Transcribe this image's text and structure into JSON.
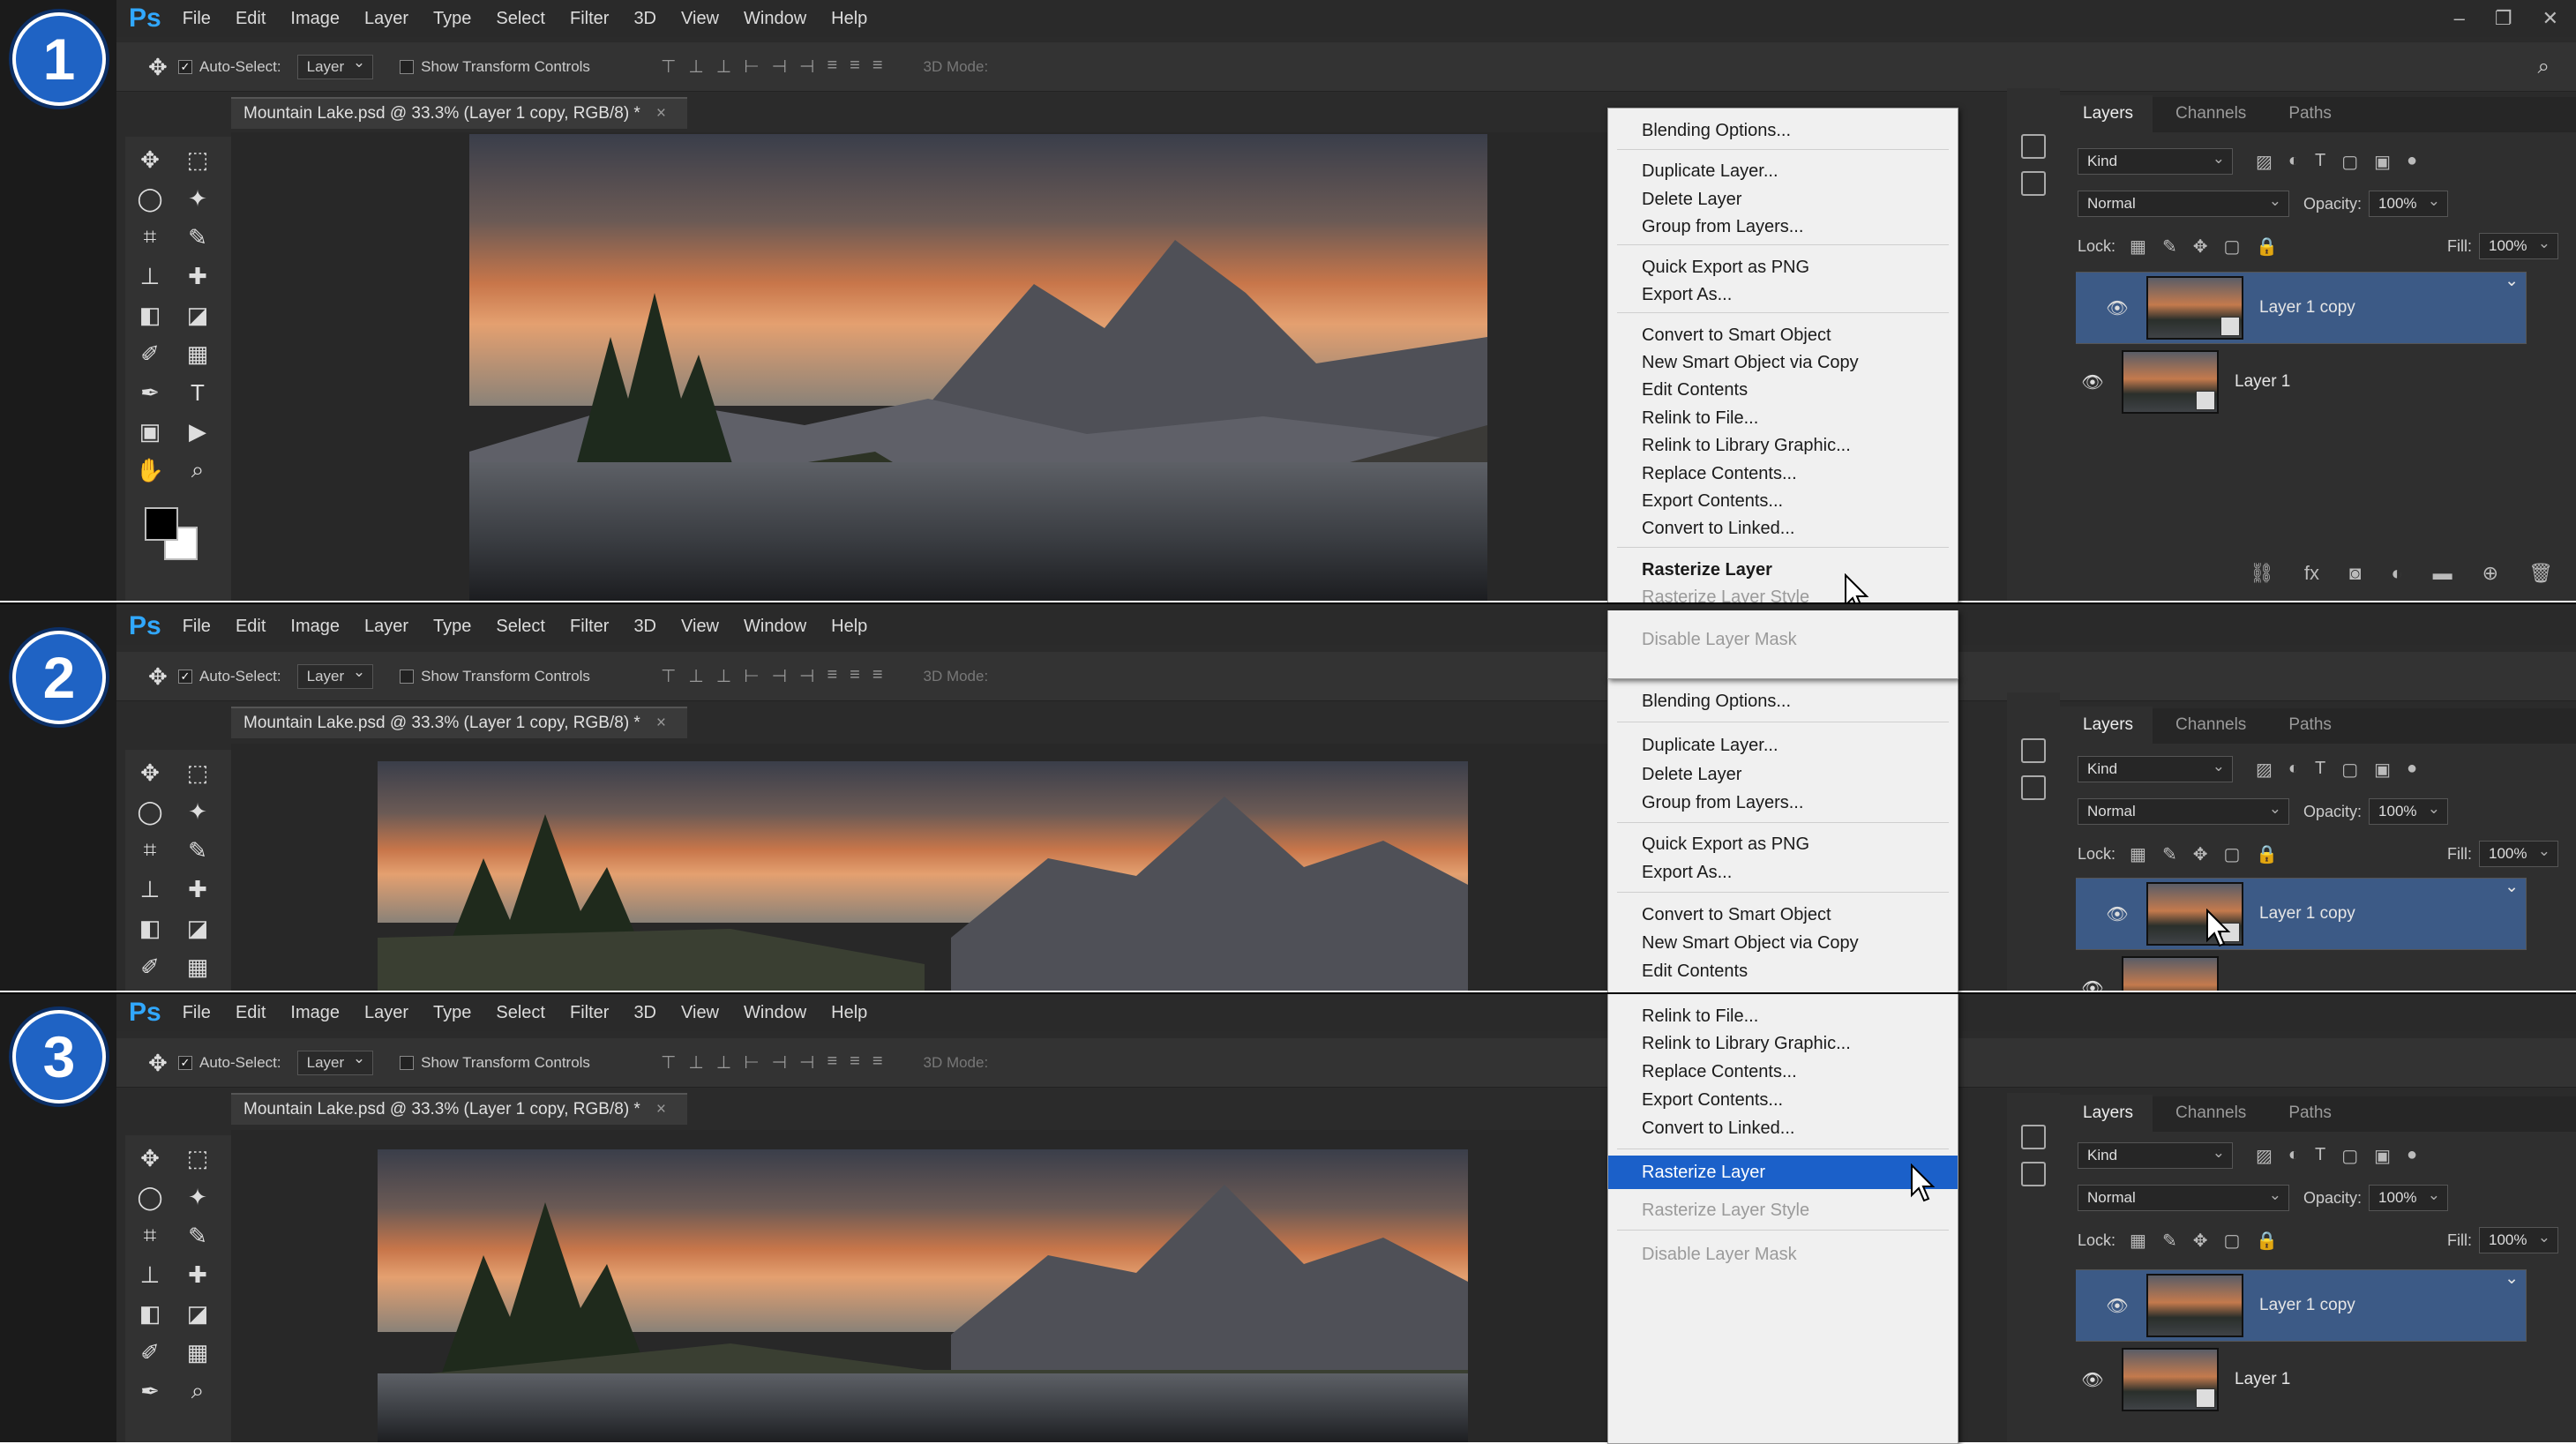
{
  "app": {
    "logo": "Ps",
    "menus": [
      "File",
      "Edit",
      "Image",
      "Layer",
      "Type",
      "Select",
      "Filter",
      "3D",
      "View",
      "Window",
      "Help"
    ]
  },
  "options": {
    "auto_select": "Auto-Select:",
    "layer_select": "Layer",
    "show_transform": "Show Transform Controls",
    "mode_3d": "3D Mode:"
  },
  "document": {
    "tab_title": "Mountain Lake.psd @ 33.3% (Layer 1 copy, RGB/8) *"
  },
  "layers_panel": {
    "tabs": [
      "Layers",
      "Channels",
      "Paths"
    ],
    "kind": "Kind",
    "blend": "Normal",
    "opacity_label": "Opacity:",
    "opacity": "100%",
    "lock_label": "Lock:",
    "fill_label": "Fill:",
    "fill": "100%",
    "layers": [
      "Layer 1 copy",
      "Layer 1"
    ]
  },
  "context_menu": {
    "items": [
      "Blending Options...",
      "Duplicate Layer...",
      "Delete Layer",
      "Group from Layers...",
      "Quick Export as PNG",
      "Export As...",
      "Convert to Smart Object",
      "New Smart Object via Copy",
      "Edit Contents",
      "Relink to File...",
      "Relink to Library Graphic...",
      "Replace Contents...",
      "Export Contents...",
      "Convert to Linked...",
      "Rasterize Layer",
      "Rasterize Layer Style",
      "Disable Layer Mask"
    ]
  },
  "steps": [
    "1",
    "2",
    "3"
  ],
  "colors": {
    "accent": "#1b60c9",
    "badge": "#1f63c4",
    "layer_selected": "#3c5a86"
  }
}
